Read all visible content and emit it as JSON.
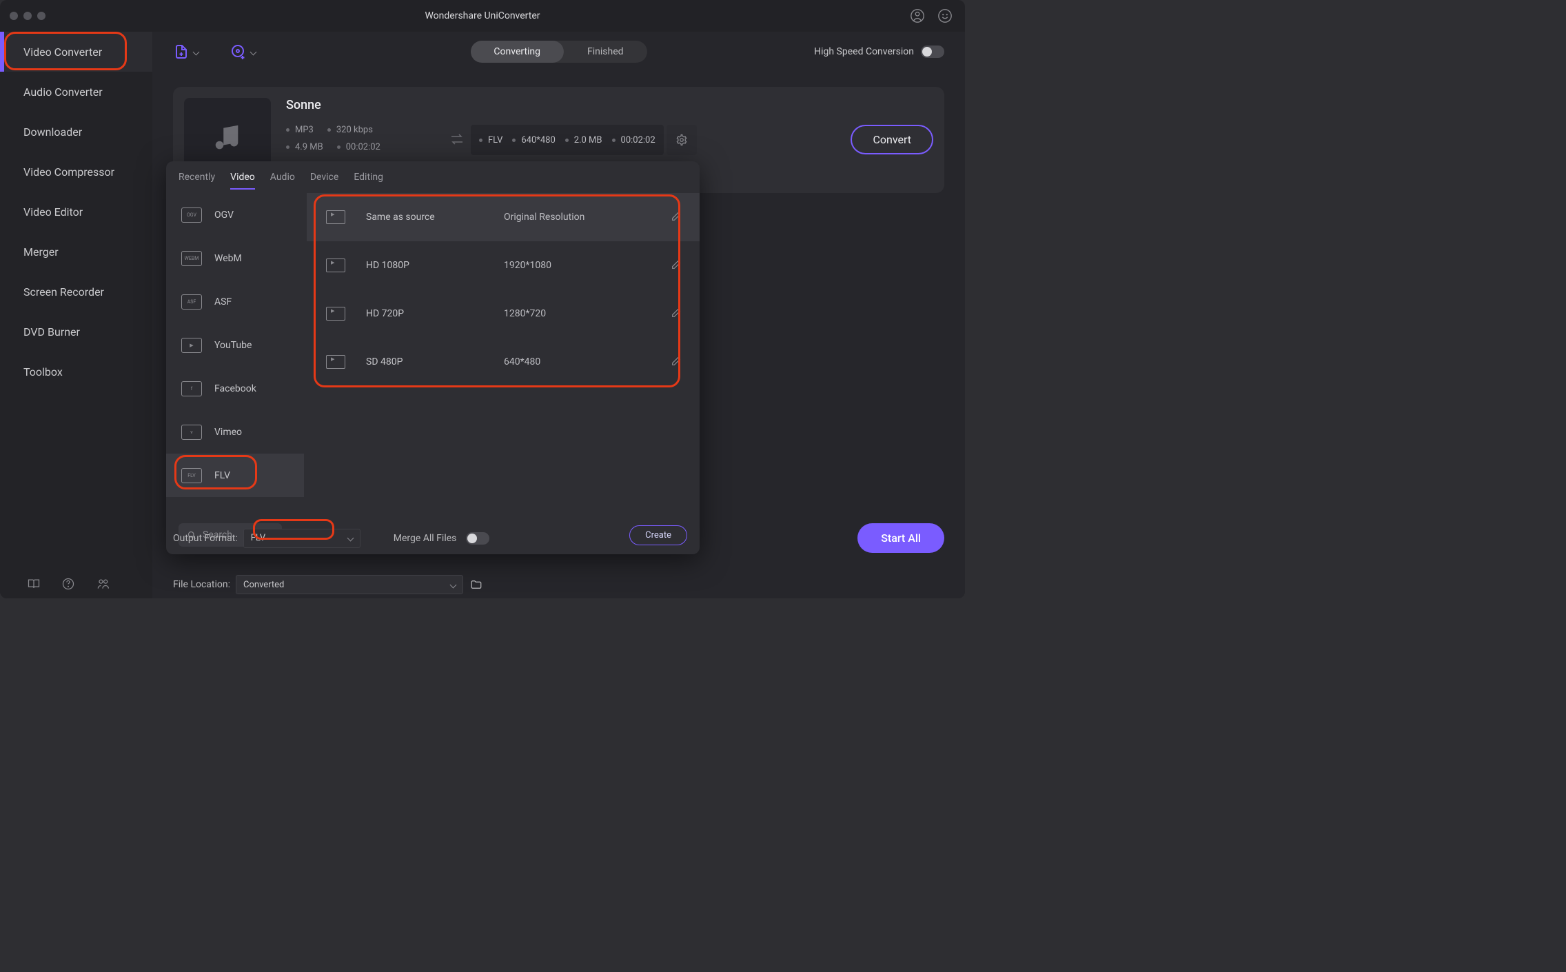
{
  "title": "Wondershare UniConverter",
  "sidebar": {
    "items": [
      {
        "label": "Video Converter"
      },
      {
        "label": "Audio Converter"
      },
      {
        "label": "Downloader"
      },
      {
        "label": "Video Compressor"
      },
      {
        "label": "Video Editor"
      },
      {
        "label": "Merger"
      },
      {
        "label": "Screen Recorder"
      },
      {
        "label": "DVD Burner"
      },
      {
        "label": "Toolbox"
      }
    ]
  },
  "topbar": {
    "seg_converting": "Converting",
    "seg_finished": "Finished",
    "high_speed": "High Speed Conversion"
  },
  "file": {
    "name": "Sonne",
    "src": {
      "fmt": "MP3",
      "bitrate": "320 kbps",
      "size": "4.9 MB",
      "dur": "00:02:02"
    },
    "tgt": {
      "fmt": "FLV",
      "res": "640*480",
      "size": "2.0 MB",
      "dur": "00:02:02"
    },
    "convert": "Convert"
  },
  "drop": {
    "tabs": {
      "recently": "Recently",
      "video": "Video",
      "audio": "Audio",
      "device": "Device",
      "editing": "Editing"
    },
    "formats": [
      {
        "label": "OGV",
        "badge": "OGV"
      },
      {
        "label": "WebM",
        "badge": "WEBM"
      },
      {
        "label": "ASF",
        "badge": "ASF"
      },
      {
        "label": "YouTube",
        "badge": "▶"
      },
      {
        "label": "Facebook",
        "badge": "f"
      },
      {
        "label": "Vimeo",
        "badge": "v"
      },
      {
        "label": "FLV",
        "badge": "FLV"
      }
    ],
    "resolutions": [
      {
        "t": "Same as source",
        "s": "Original Resolution"
      },
      {
        "t": "HD 1080P",
        "s": "1920*1080"
      },
      {
        "t": "HD 720P",
        "s": "1280*720"
      },
      {
        "t": "SD 480P",
        "s": "640*480"
      }
    ],
    "search_placeholder": "Search",
    "create": "Create"
  },
  "bottom": {
    "output_format": "Output Format:",
    "output_value": "FLV",
    "merge_all": "Merge All Files",
    "file_location": "File Location:",
    "location_value": "Converted",
    "start_all": "Start All"
  }
}
